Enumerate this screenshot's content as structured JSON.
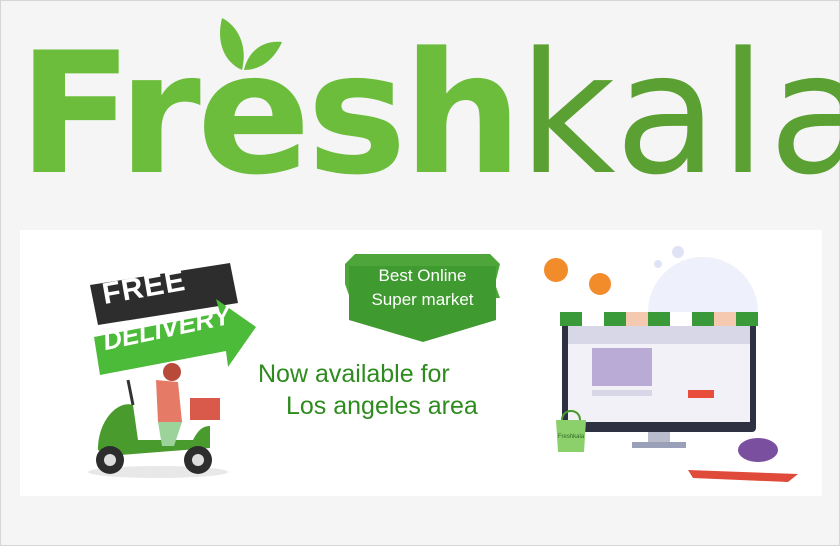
{
  "brand": {
    "part1": "Fresh",
    "part2": "kala"
  },
  "promo": {
    "free": "FREE",
    "delivery": "DELIVERY"
  },
  "ribbon": {
    "line1": "Best Online",
    "line2": "Super market"
  },
  "tagline": {
    "line1": "Now available for",
    "line2": "Los angeles area"
  },
  "bag_label": "Freshkala",
  "colors": {
    "brand_green": "#6cbd3c",
    "brand_green_dark": "#5ba032",
    "tagline_green": "#2e8b1e",
    "sign_dark": "#2d2d2d"
  }
}
